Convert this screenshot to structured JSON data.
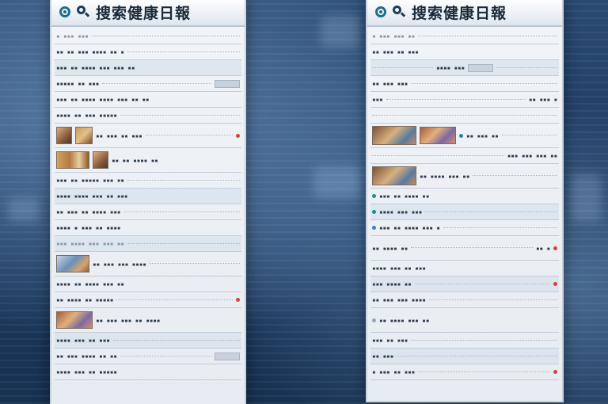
{
  "left_panel": {
    "title": "搜索健康日報"
  },
  "right_panel": {
    "title": "搜索健康日報"
  },
  "colors": {
    "accent_teal": "#1f6f88",
    "panel_bg": "#eef2f6",
    "background_blue": "#1e3a60",
    "alert_red": "#d0453a"
  },
  "icons": {
    "left_title_icon": "circle-icon",
    "right_title_icon": "circle-icon",
    "right_search_icon": "search-icon"
  }
}
